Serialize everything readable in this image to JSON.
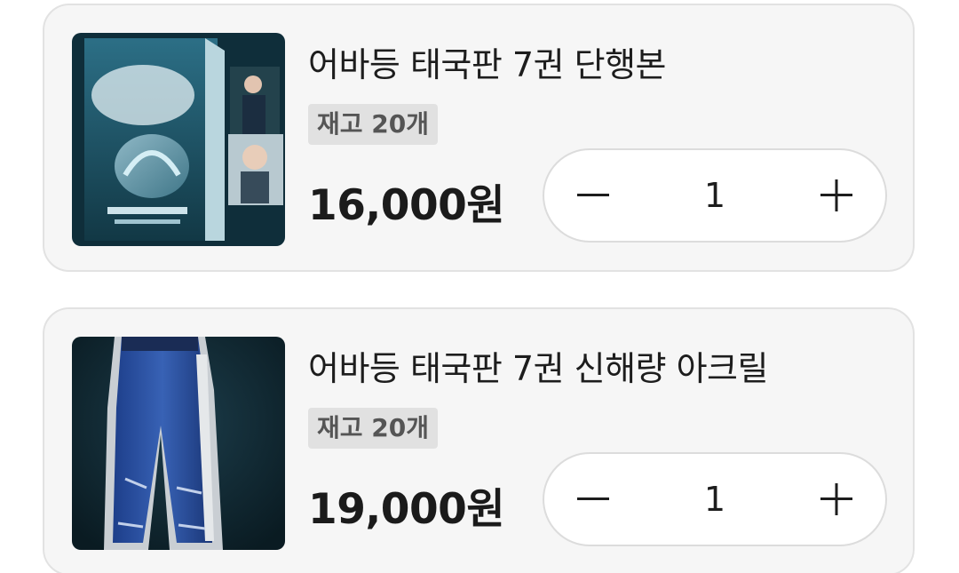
{
  "cart": {
    "items": [
      {
        "title": "어바등 태국판 7권 단행본",
        "stock": "재고 20개",
        "price": "16,000원",
        "quantity": "1",
        "image": "book-cover-image"
      },
      {
        "title": "어바등 태국판 7권 신해량 아크릴",
        "stock": "재고 20개",
        "price": "19,000원",
        "quantity": "1",
        "image": "acrylic-stand-image"
      }
    ],
    "icons": {
      "decrease": "minus-icon",
      "increase": "plus-icon"
    }
  },
  "colors": {
    "card_background": "#f6f6f6",
    "card_border": "#e2e2e2",
    "badge_background": "#e1e1e1",
    "text": "#1d1d1d",
    "badge_text": "#555555"
  }
}
